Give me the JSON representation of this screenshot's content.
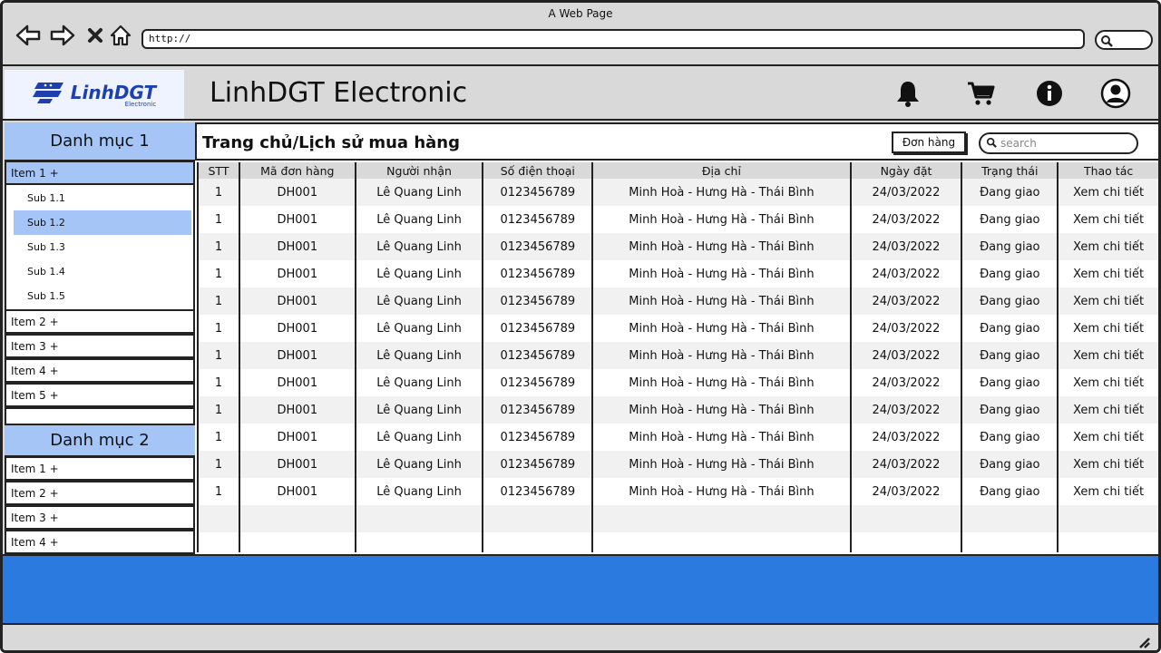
{
  "browser": {
    "window_title": "A Web Page",
    "url": "http://"
  },
  "header": {
    "logo_text": "LinhDGT",
    "logo_sub": "Electronic",
    "app_title": "LinhDGT Electronic",
    "icons": [
      "bell-icon",
      "cart-icon",
      "info-icon",
      "user-icon"
    ]
  },
  "sidebar": {
    "category1": {
      "title": "Danh mục 1",
      "items": [
        "Item 1 +",
        "Item 2 +",
        "Item 3 +",
        "Item 4 +",
        "Item 5 +"
      ],
      "subitems": [
        "Sub 1.1",
        "Sub 1.2",
        "Sub 1.3",
        "Sub 1.4",
        "Sub 1.5"
      ]
    },
    "category2": {
      "title": "Danh mục 2",
      "items": [
        "Item 1 +",
        "Item 2 +",
        "Item 3 +",
        "Item 4 +"
      ]
    }
  },
  "main": {
    "breadcrumb": "Trang chủ/Lịch sử mua hàng",
    "order_button": "Đơn hàng",
    "search_placeholder": "search"
  },
  "table": {
    "columns": [
      "STT",
      "Mã đơn hàng",
      "Người nhận",
      "Số điện thoại",
      "Địa chỉ",
      "Ngày đặt",
      "Trạng thái",
      "Thao tác"
    ],
    "rows": [
      [
        "1",
        "DH001",
        "Lê Quang Linh",
        "0123456789",
        "Minh Hoà - Hưng Hà - Thái Bình",
        "24/03/2022",
        "Đang giao",
        "Xem chi tiết"
      ],
      [
        "1",
        "DH001",
        "Lê Quang Linh",
        "0123456789",
        "Minh Hoà - Hưng Hà - Thái Bình",
        "24/03/2022",
        "Đang giao",
        "Xem chi tiết"
      ],
      [
        "1",
        "DH001",
        "Lê Quang Linh",
        "0123456789",
        "Minh Hoà - Hưng Hà - Thái Bình",
        "24/03/2022",
        "Đang giao",
        "Xem chi tiết"
      ],
      [
        "1",
        "DH001",
        "Lê Quang Linh",
        "0123456789",
        "Minh Hoà - Hưng Hà - Thái Bình",
        "24/03/2022",
        "Đang giao",
        "Xem chi tiết"
      ],
      [
        "1",
        "DH001",
        "Lê Quang Linh",
        "0123456789",
        "Minh Hoà - Hưng Hà - Thái Bình",
        "24/03/2022",
        "Đang giao",
        "Xem chi tiết"
      ],
      [
        "1",
        "DH001",
        "Lê Quang Linh",
        "0123456789",
        "Minh Hoà - Hưng Hà - Thái Bình",
        "24/03/2022",
        "Đang giao",
        "Xem chi tiết"
      ],
      [
        "1",
        "DH001",
        "Lê Quang Linh",
        "0123456789",
        "Minh Hoà - Hưng Hà - Thái Bình",
        "24/03/2022",
        "Đang giao",
        "Xem chi tiết"
      ],
      [
        "1",
        "DH001",
        "Lê Quang Linh",
        "0123456789",
        "Minh Hoà - Hưng Hà - Thái Bình",
        "24/03/2022",
        "Đang giao",
        "Xem chi tiết"
      ],
      [
        "1",
        "DH001",
        "Lê Quang Linh",
        "0123456789",
        "Minh Hoà - Hưng Hà - Thái Bình",
        "24/03/2022",
        "Đang giao",
        "Xem chi tiết"
      ],
      [
        "1",
        "DH001",
        "Lê Quang Linh",
        "0123456789",
        "Minh Hoà - Hưng Hà - Thái Bình",
        "24/03/2022",
        "Đang giao",
        "Xem chi tiết"
      ],
      [
        "1",
        "DH001",
        "Lê Quang Linh",
        "0123456789",
        "Minh Hoà - Hưng Hà - Thái Bình",
        "24/03/2022",
        "Đang giao",
        "Xem chi tiết"
      ],
      [
        "1",
        "DH001",
        "Lê Quang Linh",
        "0123456789",
        "Minh Hoà - Hưng Hà - Thái Bình",
        "24/03/2022",
        "Đang giao",
        "Xem chi tiết"
      ]
    ]
  },
  "colors": {
    "accent_light_blue": "#a6c5f7",
    "footer_blue": "#2b7ae0",
    "chrome_gray": "#d9d9d9",
    "logo_blue": "#1e3fb0"
  }
}
